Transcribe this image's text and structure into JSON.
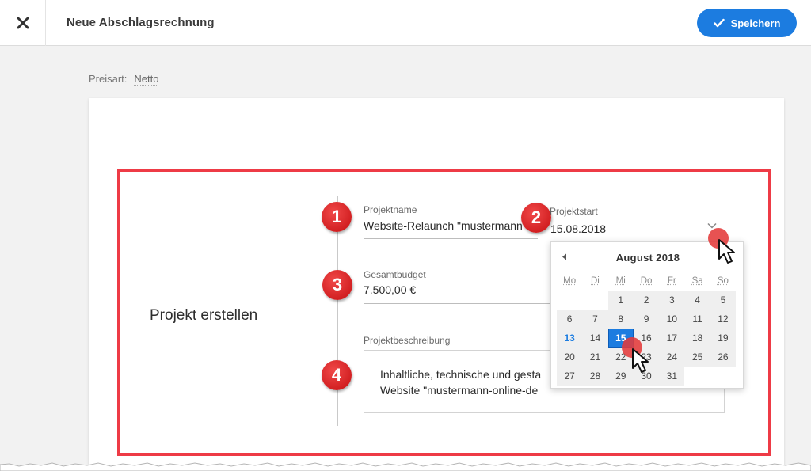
{
  "header": {
    "title": "Neue Abschlagsrechnung",
    "save_label": "Speichern"
  },
  "price_type": {
    "label": "Preisart:",
    "value": "Netto"
  },
  "section": {
    "title": "Projekt erstellen"
  },
  "badges": [
    "1",
    "2",
    "3",
    "4"
  ],
  "fields": {
    "project_name": {
      "label": "Projektname",
      "value": "Website-Relaunch \"mustermann"
    },
    "project_start": {
      "label": "Projektstart",
      "value": "15.08.2018"
    },
    "budget": {
      "label": "Gesamtbudget",
      "value": "7.500,00 €"
    },
    "description": {
      "label": "Projektbeschreibung",
      "line1": "Inhaltliche, technische und gesta",
      "line2": "Website \"mustermann-online-de"
    }
  },
  "calendar": {
    "month_label": "August 2018",
    "weekdays": [
      "Mo",
      "Di",
      "Mi",
      "Do",
      "Fr",
      "Sa",
      "So"
    ],
    "leading_blanks": 2,
    "days_in_month": 31,
    "today": 13,
    "selected": 15
  },
  "colors": {
    "accent": "#1c7ce0",
    "highlight": "#ee3b46",
    "badge": "#d21c1f"
  }
}
